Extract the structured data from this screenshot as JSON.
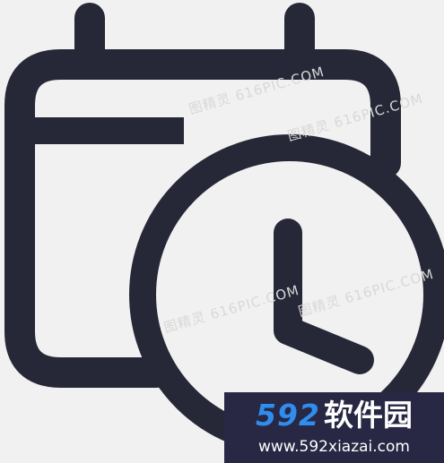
{
  "icon": {
    "name": "calendar-clock-icon",
    "stroke_color": "#262837",
    "background_color": "#f2f1f1"
  },
  "watermarks": [
    {
      "text": "图精灵 616PIC.COM"
    },
    {
      "text": "图精灵 616PIC.COM"
    },
    {
      "text": "图精灵 616PIC.COM"
    },
    {
      "text": "图精灵 616PIC.COM"
    }
  ],
  "badge": {
    "brand_number": "592",
    "brand_name": "软件园",
    "url": "www.592xiazai.com",
    "background_color": "#282845",
    "number_color": "#2f8dee"
  }
}
